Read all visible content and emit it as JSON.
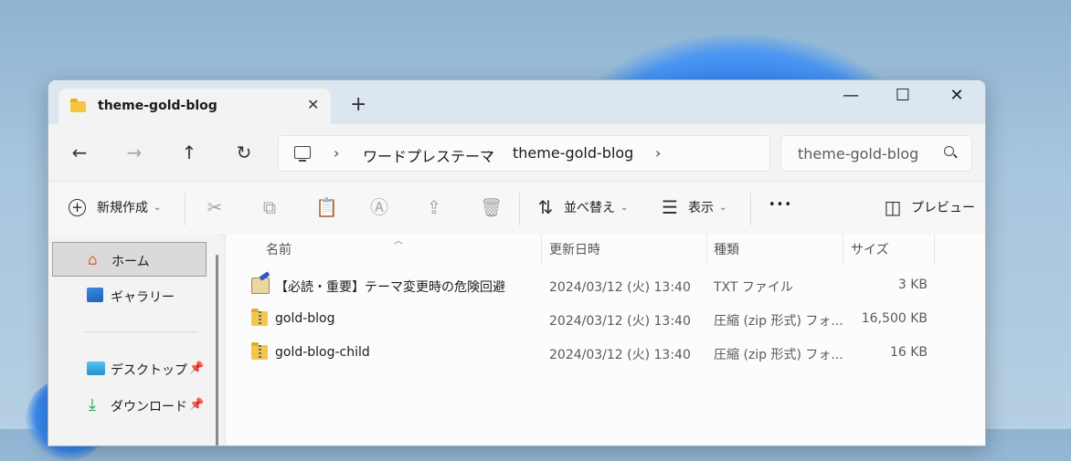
{
  "tab": {
    "title": "theme-gold-blog",
    "close_glyph": "✕",
    "new_tab_glyph": "+"
  },
  "window_controls": {
    "minimize": "—",
    "maximize": "☐",
    "close": "✕"
  },
  "nav": {
    "back": "←",
    "forward": "→",
    "up": "↑",
    "refresh": "↻",
    "breadcrumb": [
      "ワードプレステーマ",
      "theme-gold-blog"
    ],
    "chevron": "›",
    "search_placeholder": "theme-gold-blog"
  },
  "toolbar": {
    "new_label": "新規作成",
    "sort_label": "並べ替え",
    "view_label": "表示",
    "more_glyph": "•••",
    "preview_label": "プレビュー",
    "caret": "⌄"
  },
  "sidebar": {
    "items": [
      {
        "label": "ホーム",
        "icon": "home-icon",
        "selected": true
      },
      {
        "label": "ギャラリー",
        "icon": "gallery-icon",
        "selected": false
      },
      {
        "label": "デスクトップ",
        "icon": "desktop-icon",
        "pinned": true
      },
      {
        "label": "ダウンロード",
        "icon": "download-icon",
        "pinned": true
      }
    ],
    "pin_glyph": "📌"
  },
  "columns": [
    "名前",
    "更新日時",
    "種類",
    "サイズ"
  ],
  "files": [
    {
      "name": "【必読・重要】テーマ変更時の危険回避",
      "modified": "2024/03/12 (火) 13:40",
      "type": "TXT ファイル",
      "size": "3 KB",
      "icon": "text-file-icon"
    },
    {
      "name": "gold-blog",
      "modified": "2024/03/12 (火) 13:40",
      "type": "圧縮 (zip 形式) フォ...",
      "size": "16,500 KB",
      "icon": "zip-folder-icon"
    },
    {
      "name": "gold-blog-child",
      "modified": "2024/03/12 (火) 13:40",
      "type": "圧縮 (zip 形式) フォ...",
      "size": "16 KB",
      "icon": "zip-folder-icon"
    }
  ],
  "colors": {
    "accent": "#0067c0",
    "folder": "#f6c643",
    "titlebar": "#dbe6f1"
  }
}
